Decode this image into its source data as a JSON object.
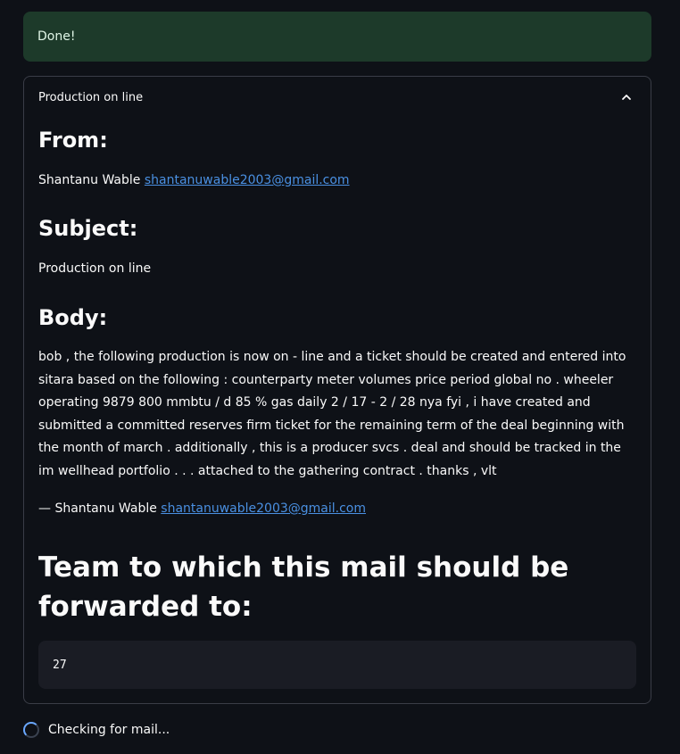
{
  "alert": {
    "text": "Done!"
  },
  "expander": {
    "title": "Production on line",
    "from_heading": "From:",
    "from_name": "Shantanu Wable",
    "from_email": "shantanuwable2003@gmail.com",
    "subject_heading": "Subject:",
    "subject_text": "Production on line",
    "body_heading": "Body:",
    "body_text": "bob , the following production is now on - line and a ticket should be created and entered into sitara based on the following : counterparty meter volumes price period global no . wheeler operating 9879 800 mmbtu / d 85 % gas daily 2 / 17 - 2 / 28 nya fyi , i have created and submitted a committed reserves firm ticket for the remaining term of the deal beginning with the month of march . additionally , this is a producer svcs . deal and should be tracked in the im wellhead portfolio . . . attached to the gathering contract . thanks , vlt",
    "signature_prefix": "— Shantanu Wable",
    "signature_email": "shantanuwable2003@gmail.com",
    "team_heading": "Team to which this mail should be forwarded to:",
    "team_value": "27"
  },
  "status": {
    "text": "Checking for mail..."
  },
  "colors": {
    "background": "#0e1117",
    "success_bg": "#1d3a2a",
    "link": "#4a90e2",
    "code_bg": "#1a1c24"
  },
  "icons": {
    "expander_toggle": "chevron-up-icon",
    "status": "spinner-icon"
  }
}
